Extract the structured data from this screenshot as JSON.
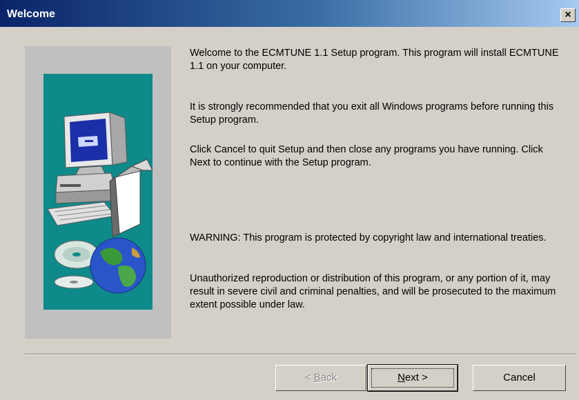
{
  "window": {
    "title": "Welcome",
    "close_glyph": "×"
  },
  "illustration": {
    "panel_bg": "#c0c0c0",
    "teal_bg": "#0f8a8a",
    "icons": [
      "computer-icon",
      "software-box-icon",
      "cd-disc-icon",
      "globe-icon"
    ]
  },
  "body": {
    "para1": "Welcome to the ECMTUNE 1.1 Setup program.  This program will install ECMTUNE 1.1 on your computer.",
    "para2": "It is strongly recommended that you exit all Windows programs before running this Setup program.",
    "para3": "Click Cancel to quit Setup and then close any programs you have running.  Click Next to continue with the Setup program.",
    "para4": "WARNING: This program is protected by copyright law and international treaties.",
    "para5": "Unauthorized reproduction or distribution of this program, or any portion of it, may result in severe civil and criminal penalties, and will be prosecuted to the maximum extent possible under law."
  },
  "buttons": {
    "back_prefix": "< ",
    "back_accel": "B",
    "back_rest": "ack",
    "next_accel": "N",
    "next_rest": "ext",
    "next_suffix": " >",
    "cancel": "Cancel"
  },
  "colors": {
    "titlebar_start": "#0a246a",
    "titlebar_end": "#a6caf0",
    "face": "#d4d0c8"
  }
}
